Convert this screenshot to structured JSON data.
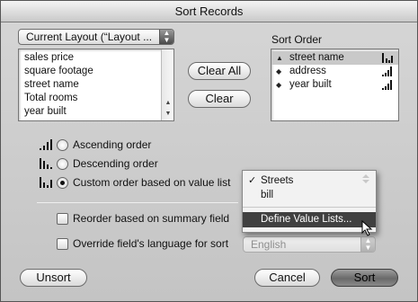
{
  "window": {
    "title": "Sort Records"
  },
  "layout_popup": {
    "value": "Current Layout (“Layout ..."
  },
  "field_list": {
    "items": [
      "sales price",
      "square footage",
      "street name",
      "Total rooms",
      "year built"
    ]
  },
  "buttons": {
    "clear_all": "Clear All",
    "clear": "Clear",
    "unsort": "Unsort",
    "cancel": "Cancel",
    "sort": "Sort"
  },
  "sort_order": {
    "heading": "Sort Order",
    "rows": [
      {
        "label": "street name",
        "selected": true,
        "order": "custom"
      },
      {
        "label": "address",
        "selected": false,
        "order": "ascending"
      },
      {
        "label": "year built",
        "selected": false,
        "order": "ascending"
      }
    ]
  },
  "order_options": {
    "ascending": "Ascending order",
    "descending": "Descending order",
    "custom": "Custom order based on value list",
    "selected": "custom"
  },
  "value_list_menu": {
    "items": [
      "Streets",
      "bill",
      "Define Value Lists..."
    ],
    "checked": "Streets",
    "highlighted": "Define Value Lists..."
  },
  "checkboxes": {
    "reorder_summary": "Reorder based on summary field",
    "override_language": "Override field's language for sort"
  },
  "language_popup": {
    "value": "English"
  },
  "icons": {
    "ascending": "ascending-order-icon",
    "descending": "descending-order-icon",
    "custom": "custom-order-icon"
  },
  "colors": {
    "menu_highlight": "#404040",
    "selected_row": "#c9c9c9"
  }
}
